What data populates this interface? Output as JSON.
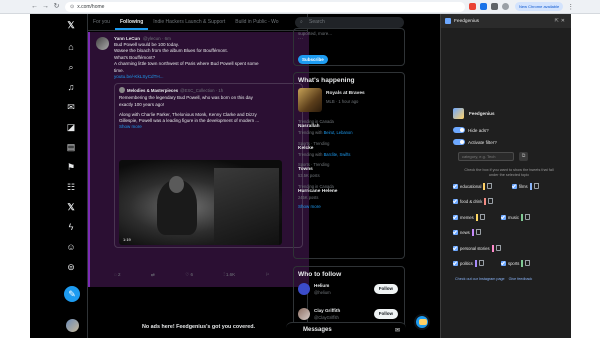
{
  "browser": {
    "url": "x.com/home",
    "update_label": "New Chrome available",
    "back_icon": "arrow-left-icon",
    "forward_icon": "arrow-right-icon",
    "reload_icon": "reload-icon",
    "menu_icon": "kebab-icon"
  },
  "nav": {
    "icons": [
      "x-logo-icon",
      "home-icon",
      "search-icon",
      "notifications-icon",
      "messages-icon",
      "grok-icon",
      "lists-icon",
      "bookmarks-icon",
      "communities-icon",
      "premium-icon",
      "verified-orgs-icon",
      "profile-icon",
      "more-icon"
    ]
  },
  "timeline": {
    "tabs": [
      "For you",
      "Following",
      "Indie Hackers Launch & Support",
      "Build in Public - Wo"
    ],
    "active_tab": "Following",
    "tweet": {
      "name": "Yann LeCun",
      "handle": "@ylecun · 6m",
      "lines": [
        "Bud Powell would be 100 today.",
        "Wasee the bloach from the album Blues for Bouffémont.",
        "What's Bouffémont?",
        "A charming little town northwest of Paris where Bud Powell spent some",
        "time."
      ],
      "link": "youtu.be/-KkLSyCdTH...",
      "quote": {
        "name": "Melodies & Masterpieces",
        "handle": "@ESC_Collection · 1h",
        "lines": [
          "Remembering the legendary Bud Powell, who was born on this day",
          "exactly 100 years ago!",
          "",
          "Along with Charlie Parker, Thelonious Monk, Kenny Clarke and Dizzy",
          "Gillespie, Powell was a leading figure in the development of modern ..."
        ],
        "show_more": "Show more",
        "duration": "1:19"
      },
      "actions": {
        "reply": "2",
        "repost": "",
        "like": "6",
        "views": "1.6K"
      }
    },
    "footer": "No ads here! Feedgenius's got you covered."
  },
  "sidebar": {
    "search_placeholder": "Search",
    "subscribe_text": "suported, more...",
    "subscribe_label": "Subscribe",
    "happening_title": "What's happening",
    "featured": {
      "title": "Royals at Braves",
      "sub": "MLB · 1 hour ago"
    },
    "trends": [
      {
        "cat": "Trending in Canada",
        "name": "Nasrallah",
        "sub": "Trending with ",
        "link": "Beirut, Lebanon"
      },
      {
        "cat": "Sports · Trending",
        "name": "Kelcke",
        "sub": "Trending with ",
        "link": "Barclite, Swifts"
      },
      {
        "cat": "Sports · Trending",
        "name": "Towns",
        "sub": "53.5K posts",
        "link": ""
      },
      {
        "cat": "Trending in Canada",
        "name": "Hurricane Helene",
        "sub": "245K posts",
        "link": ""
      }
    ],
    "show_more": "Show more",
    "follow_title": "Who to follow",
    "follow": [
      {
        "name": "Helium",
        "handle": "@helium",
        "button": "Follow"
      },
      {
        "name": "Clay Griffith",
        "handle": "@ClayGriffith",
        "button": "Follow"
      }
    ],
    "messages_label": "Messages"
  },
  "panel": {
    "title": "Feedgenius",
    "app_name": "Feedgenius",
    "hide_ads": "Hide ads?",
    "activate_filter": "Activate filter?",
    "category_placeholder": "category, e.g. Tech",
    "hint_line1": "Check the box if you want to show the tweets that fall",
    "hint_line2": "under the selected topic",
    "categories": [
      {
        "name": "educational",
        "color": "#ffd166"
      },
      {
        "name": "films",
        "color": "#8ab4f8"
      },
      {
        "name": "food & drink",
        "color": "#f28b82"
      },
      {
        "name": "memes",
        "color": "#fdd663"
      },
      {
        "name": "music",
        "color": "#81c995"
      },
      {
        "name": "news",
        "color": "#c58af9"
      },
      {
        "name": "personal stories",
        "color": "#ff8bcb"
      },
      {
        "name": "politics",
        "color": "#a78bfa"
      },
      {
        "name": "sports",
        "color": "#81c995"
      }
    ],
    "link1": "Check out our Instagram page",
    "link2": "Give feedback"
  }
}
